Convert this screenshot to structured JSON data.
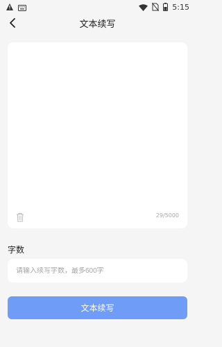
{
  "status_bar": {
    "time": "5:15",
    "icons": [
      "warning-icon",
      "keyboard-icon",
      "wifi-icon",
      "no-sim-icon",
      "battery-icon"
    ]
  },
  "header": {
    "title": "文本续写"
  },
  "editor": {
    "placeholder": "",
    "counter": "29/5000"
  },
  "length_section": {
    "label": "字数",
    "placeholder": "请输入续写字数，最多600字"
  },
  "actions": {
    "primary_label": "文本续写"
  },
  "colors": {
    "background": "#f5f5f5",
    "card": "#ffffff",
    "primary": "#6f9cf6",
    "muted_text": "#a7a7a7"
  }
}
